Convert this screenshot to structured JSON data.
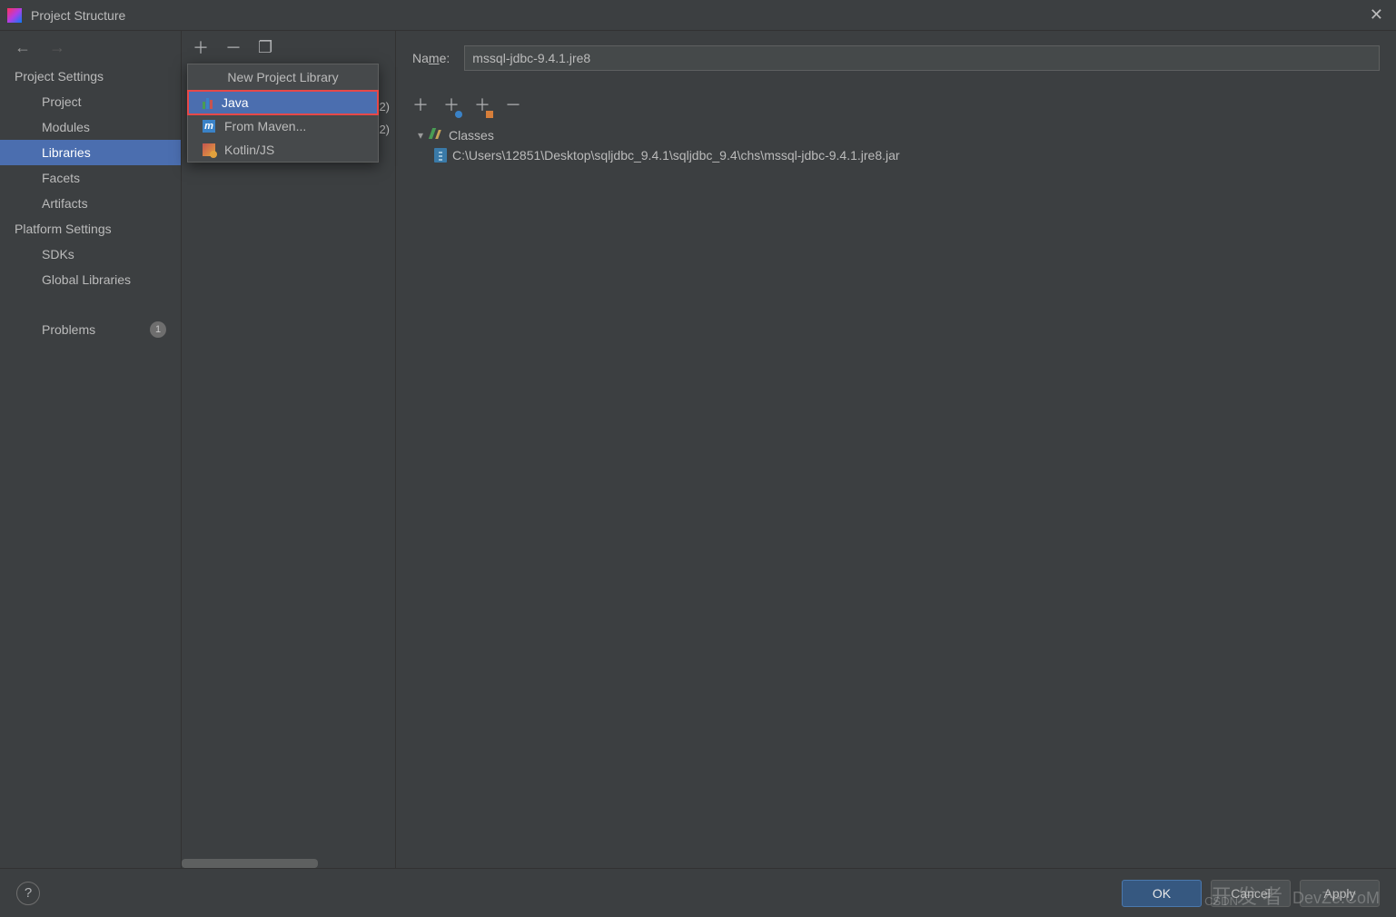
{
  "window": {
    "title": "Project Structure",
    "close_glyph": "✕"
  },
  "nav": {
    "back_glyph": "←",
    "forward_glyph": "→"
  },
  "sidebar": {
    "section_project_settings": "Project Settings",
    "section_platform_settings": "Platform Settings",
    "items": {
      "project": "Project",
      "modules": "Modules",
      "libraries": "Libraries",
      "facets": "Facets",
      "artifacts": "Artifacts",
      "sdks": "SDKs",
      "global_libraries": "Global Libraries",
      "problems": "Problems"
    },
    "problems_count": "1"
  },
  "mid_toolbar": {
    "add_glyph": "＋",
    "remove_glyph": "－",
    "copy_glyph": "❐"
  },
  "lib_behind_suffix_1": "2)",
  "lib_behind_suffix_2": "2)",
  "popup": {
    "title": "New Project Library",
    "items": {
      "java": "Java",
      "maven": "From Maven...",
      "kotlinjs": "Kotlin/JS"
    }
  },
  "detail": {
    "name_label_pre": "Na",
    "name_label_m": "m",
    "name_label_post": "e:",
    "name_value": "mssql-jdbc-9.4.1.jre8",
    "toolbar": {
      "add_glyph": "＋",
      "add_web_glyph": "＋",
      "add_folder_glyph": "＋",
      "remove_glyph": "－"
    },
    "tree": {
      "classes_label": "Classes",
      "jar_path": "C:\\Users\\12851\\Desktop\\sqljdbc_9.4.1\\sqljdbc_9.4\\chs\\mssql-jdbc-9.4.1.jre8.jar"
    }
  },
  "footer": {
    "help_glyph": "?",
    "ok_label": "OK",
    "cancel_label": "Cancel",
    "apply_label": "Apply"
  },
  "watermark": {
    "cjk": "开 发 者",
    "latin": "DevZe.CoM",
    "csdn": "CSDN"
  }
}
